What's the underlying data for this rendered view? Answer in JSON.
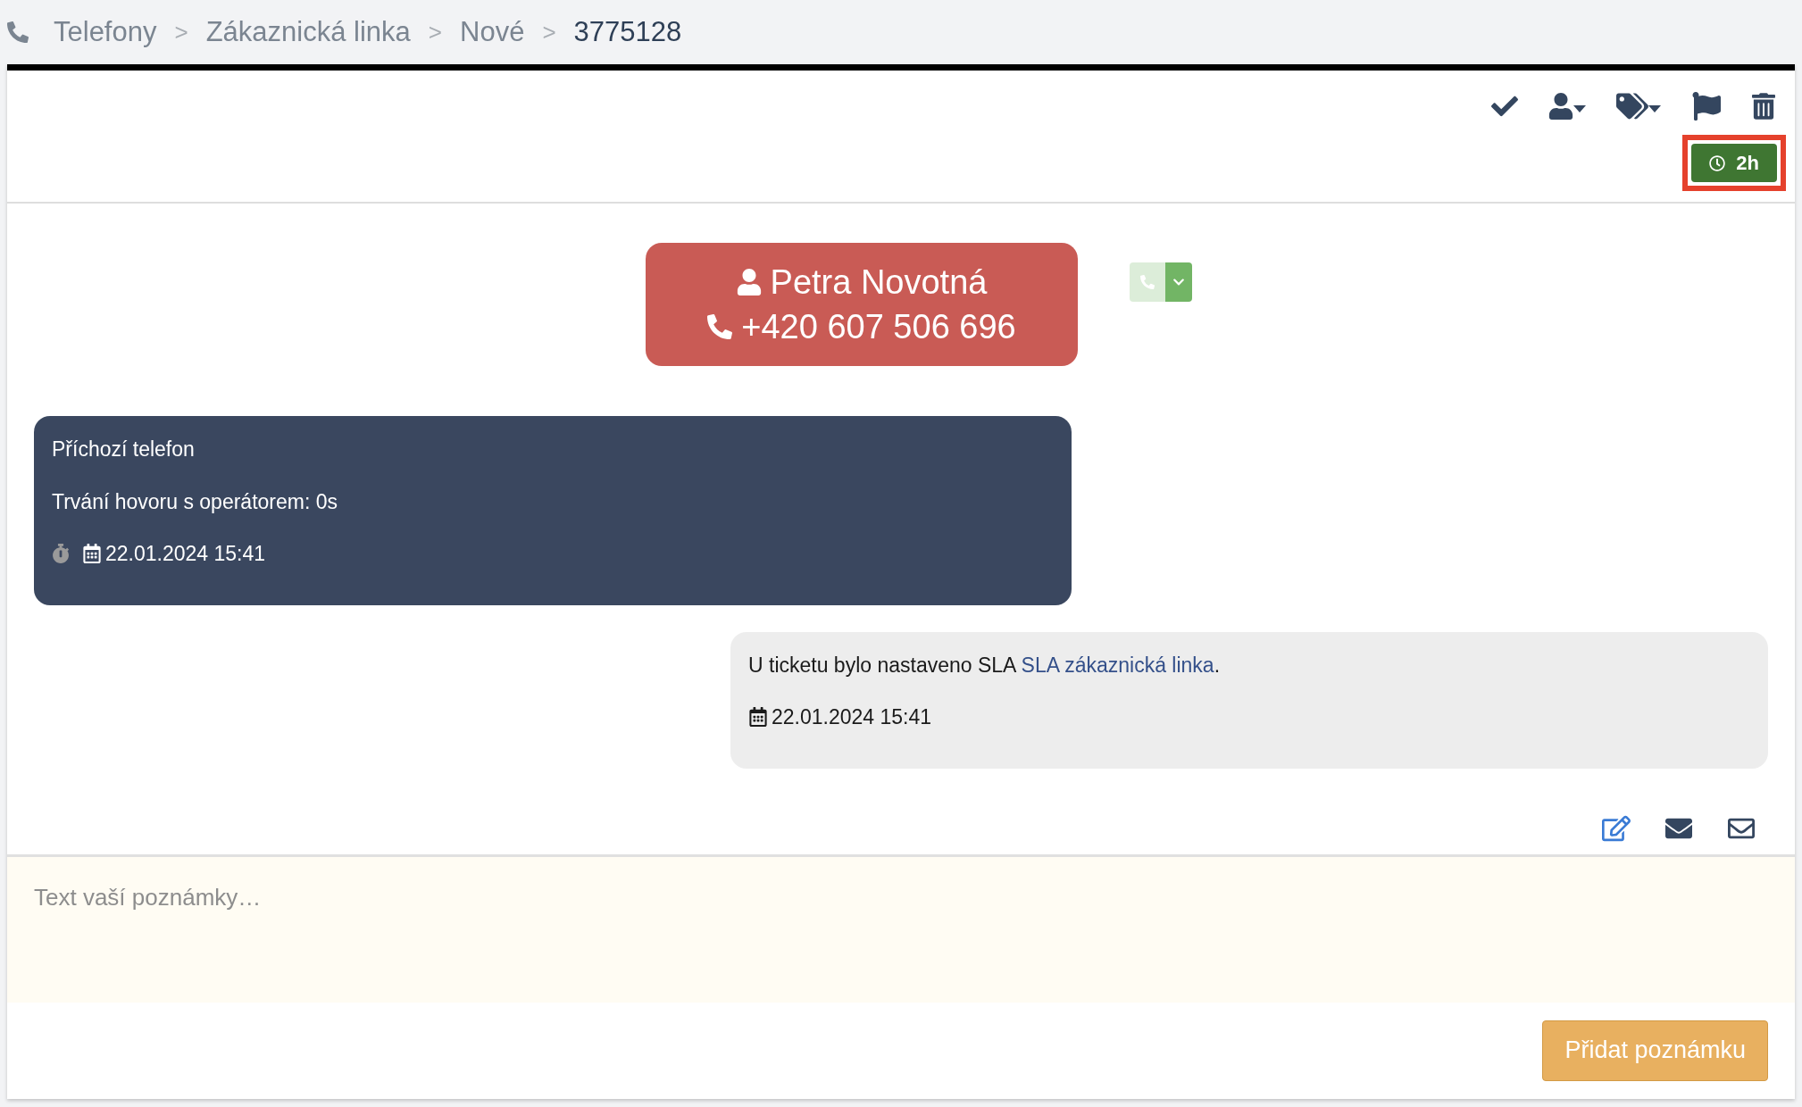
{
  "breadcrumb": [
    {
      "label": "Telefony",
      "current": false
    },
    {
      "label": "Zákaznická linka",
      "current": false
    },
    {
      "label": "Nové",
      "current": false
    },
    {
      "label": "3775128",
      "current": true
    }
  ],
  "breadcrumb_separator": ">",
  "toolbar": {
    "actions": [
      {
        "kind": "check"
      },
      {
        "kind": "assign"
      },
      {
        "kind": "tags"
      },
      {
        "kind": "flag"
      },
      {
        "kind": "delete"
      }
    ],
    "sla_badge": {
      "label": "2h",
      "highlighted": true
    }
  },
  "contact": {
    "name": "Petra Novotná",
    "phone": "+420 607 506 696"
  },
  "call_button": {
    "disabled": true
  },
  "messages": [
    {
      "kind": "call",
      "lines": [
        "Příchozí telefon",
        "Trvání hovoru s operátorem: 0s"
      ],
      "timestamp": "22.01.2024 15:41"
    },
    {
      "kind": "system",
      "text_before": "U ticketu bylo nastaveno SLA ",
      "link": "SLA zákaznická linka",
      "text_after": ".",
      "timestamp": "22.01.2024 15:41"
    }
  ],
  "reply_actions": [
    {
      "kind": "note"
    },
    {
      "kind": "email"
    },
    {
      "kind": "email-outline"
    }
  ],
  "note": {
    "placeholder": "Text vaší poznámky…",
    "submit": "Přidat poznámku"
  }
}
